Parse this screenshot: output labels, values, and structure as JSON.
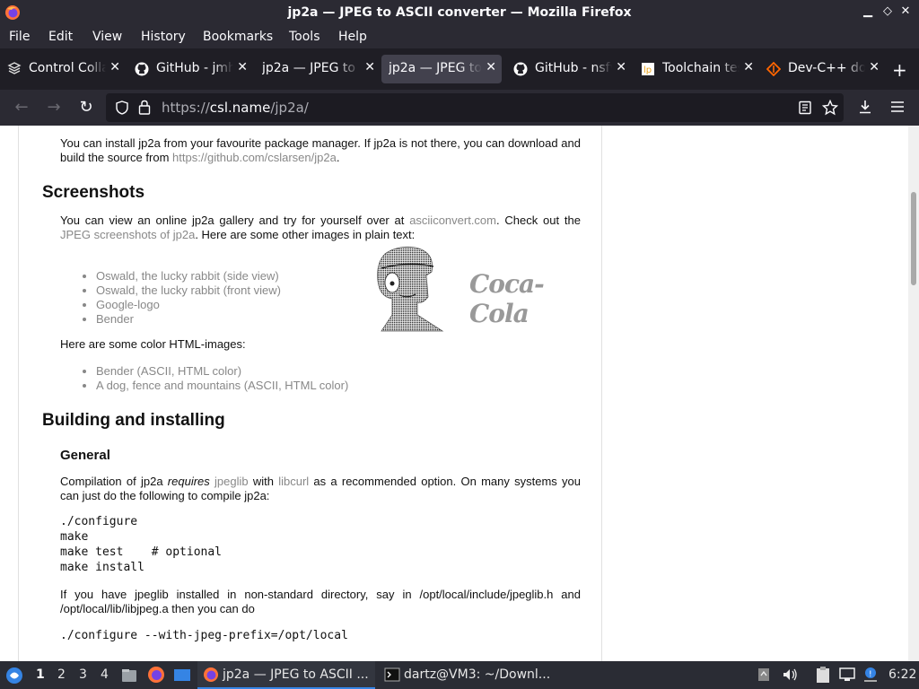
{
  "window": {
    "title": "jp2a — JPEG to ASCII converter — Mozilla Firefox",
    "controls": [
      "minimize",
      "restore",
      "close"
    ]
  },
  "menubar": [
    "File",
    "Edit",
    "View",
    "History",
    "Bookmarks",
    "Tools",
    "Help"
  ],
  "tabs": [
    {
      "label": "Control Colla",
      "icon": "control-center-icon",
      "active": false
    },
    {
      "label": "GitHub - jmh",
      "icon": "github-icon",
      "active": false
    },
    {
      "label": "jp2a — JPEG to",
      "icon": "none",
      "active": false
    },
    {
      "label": "jp2a — JPEG to",
      "icon": "none",
      "active": true
    },
    {
      "label": "GitHub - nsfv",
      "icon": "github-icon",
      "active": false
    },
    {
      "label": "Toolchain tes",
      "icon": "lp-icon",
      "active": false
    },
    {
      "label": "Dev-C++ do",
      "icon": "sourceforge-icon",
      "active": false
    }
  ],
  "navbar": {
    "url_prefix": "https://",
    "url_host": "csl.name",
    "url_path": "/jp2a/"
  },
  "page": {
    "intro_1": "You can install jp2a from your favourite package manager. If jp2a is not there, you can download and build the source from ",
    "intro_link": "https://github.com/cslarsen/jp2a",
    "intro_end": ".",
    "screenshots_heading": "Screenshots",
    "shots_1": "You can view an online jp2a gallery and try for yourself over at ",
    "shots_link1": "asciiconvert.com",
    "shots_2": ". Check out the ",
    "shots_link2": "JPEG screenshots of jp2a",
    "shots_3": ". Here are some other images in plain text:",
    "plain_list": [
      "Oswald, the lucky rabbit (side view)",
      "Oswald, the lucky rabbit (front view)",
      "Google-logo",
      "Bender"
    ],
    "color_intro": "Here are some color HTML-images:",
    "color_list": [
      "Bender (ASCII, HTML color)",
      "A dog, fence and mountains (ASCII, HTML color)"
    ],
    "coca_cola": "Coca-Cola",
    "building_heading": "Building and installing",
    "general_heading": "General",
    "compile_1": "Compilation of jp2a ",
    "compile_em": "requires",
    "compile_link1": "jpeglib",
    "compile_2": " with ",
    "compile_link2": "libcurl",
    "compile_3": " as a recommended option. On many systems you can just do the following to compile jp2a:",
    "code1": "./configure\nmake\nmake test    # optional\nmake install",
    "nonstd": "If you have jpeglib installed in non-standard directory, say in /opt/local/include/jpeglib.h and /opt/local/lib/libjpeg.a then you can do",
    "code2": "./configure --with-jpeg-prefix=/opt/local"
  },
  "taskbar": {
    "workspaces": [
      "1",
      "2",
      "3",
      "4"
    ],
    "active_workspace": "1",
    "tasks": [
      {
        "label": "jp2a — JPEG to ASCII ...",
        "active": true
      },
      {
        "label": "dartz@VM3: ~/Downl...",
        "active": false
      }
    ],
    "clock": "6:22"
  },
  "colors": {
    "chrome_bg": "#2b2a33",
    "tabbar_bg": "#1f1e25",
    "active_tab": "#42414d",
    "link_gray": "#888888",
    "taskbar_bg": "#2a2c34",
    "taskbar_active_underline": "#3584e4"
  }
}
